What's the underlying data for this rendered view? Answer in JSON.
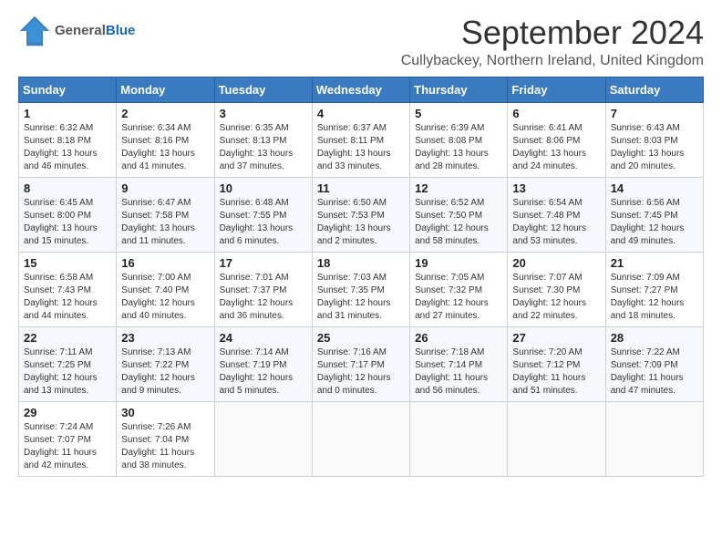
{
  "header": {
    "logo_line1": "General",
    "logo_line2": "Blue",
    "month_title": "September 2024",
    "subtitle": "Cullybackey, Northern Ireland, United Kingdom"
  },
  "days_of_week": [
    "Sunday",
    "Monday",
    "Tuesday",
    "Wednesday",
    "Thursday",
    "Friday",
    "Saturday"
  ],
  "weeks": [
    [
      {
        "day": "1",
        "sunrise": "Sunrise: 6:32 AM",
        "sunset": "Sunset: 8:18 PM",
        "daylight": "Daylight: 13 hours and 46 minutes."
      },
      {
        "day": "2",
        "sunrise": "Sunrise: 6:34 AM",
        "sunset": "Sunset: 8:16 PM",
        "daylight": "Daylight: 13 hours and 41 minutes."
      },
      {
        "day": "3",
        "sunrise": "Sunrise: 6:35 AM",
        "sunset": "Sunset: 8:13 PM",
        "daylight": "Daylight: 13 hours and 37 minutes."
      },
      {
        "day": "4",
        "sunrise": "Sunrise: 6:37 AM",
        "sunset": "Sunset: 8:11 PM",
        "daylight": "Daylight: 13 hours and 33 minutes."
      },
      {
        "day": "5",
        "sunrise": "Sunrise: 6:39 AM",
        "sunset": "Sunset: 8:08 PM",
        "daylight": "Daylight: 13 hours and 28 minutes."
      },
      {
        "day": "6",
        "sunrise": "Sunrise: 6:41 AM",
        "sunset": "Sunset: 8:06 PM",
        "daylight": "Daylight: 13 hours and 24 minutes."
      },
      {
        "day": "7",
        "sunrise": "Sunrise: 6:43 AM",
        "sunset": "Sunset: 8:03 PM",
        "daylight": "Daylight: 13 hours and 20 minutes."
      }
    ],
    [
      {
        "day": "8",
        "sunrise": "Sunrise: 6:45 AM",
        "sunset": "Sunset: 8:00 PM",
        "daylight": "Daylight: 13 hours and 15 minutes."
      },
      {
        "day": "9",
        "sunrise": "Sunrise: 6:47 AM",
        "sunset": "Sunset: 7:58 PM",
        "daylight": "Daylight: 13 hours and 11 minutes."
      },
      {
        "day": "10",
        "sunrise": "Sunrise: 6:48 AM",
        "sunset": "Sunset: 7:55 PM",
        "daylight": "Daylight: 13 hours and 6 minutes."
      },
      {
        "day": "11",
        "sunrise": "Sunrise: 6:50 AM",
        "sunset": "Sunset: 7:53 PM",
        "daylight": "Daylight: 13 hours and 2 minutes."
      },
      {
        "day": "12",
        "sunrise": "Sunrise: 6:52 AM",
        "sunset": "Sunset: 7:50 PM",
        "daylight": "Daylight: 12 hours and 58 minutes."
      },
      {
        "day": "13",
        "sunrise": "Sunrise: 6:54 AM",
        "sunset": "Sunset: 7:48 PM",
        "daylight": "Daylight: 12 hours and 53 minutes."
      },
      {
        "day": "14",
        "sunrise": "Sunrise: 6:56 AM",
        "sunset": "Sunset: 7:45 PM",
        "daylight": "Daylight: 12 hours and 49 minutes."
      }
    ],
    [
      {
        "day": "15",
        "sunrise": "Sunrise: 6:58 AM",
        "sunset": "Sunset: 7:43 PM",
        "daylight": "Daylight: 12 hours and 44 minutes."
      },
      {
        "day": "16",
        "sunrise": "Sunrise: 7:00 AM",
        "sunset": "Sunset: 7:40 PM",
        "daylight": "Daylight: 12 hours and 40 minutes."
      },
      {
        "day": "17",
        "sunrise": "Sunrise: 7:01 AM",
        "sunset": "Sunset: 7:37 PM",
        "daylight": "Daylight: 12 hours and 36 minutes."
      },
      {
        "day": "18",
        "sunrise": "Sunrise: 7:03 AM",
        "sunset": "Sunset: 7:35 PM",
        "daylight": "Daylight: 12 hours and 31 minutes."
      },
      {
        "day": "19",
        "sunrise": "Sunrise: 7:05 AM",
        "sunset": "Sunset: 7:32 PM",
        "daylight": "Daylight: 12 hours and 27 minutes."
      },
      {
        "day": "20",
        "sunrise": "Sunrise: 7:07 AM",
        "sunset": "Sunset: 7:30 PM",
        "daylight": "Daylight: 12 hours and 22 minutes."
      },
      {
        "day": "21",
        "sunrise": "Sunrise: 7:09 AM",
        "sunset": "Sunset: 7:27 PM",
        "daylight": "Daylight: 12 hours and 18 minutes."
      }
    ],
    [
      {
        "day": "22",
        "sunrise": "Sunrise: 7:11 AM",
        "sunset": "Sunset: 7:25 PM",
        "daylight": "Daylight: 12 hours and 13 minutes."
      },
      {
        "day": "23",
        "sunrise": "Sunrise: 7:13 AM",
        "sunset": "Sunset: 7:22 PM",
        "daylight": "Daylight: 12 hours and 9 minutes."
      },
      {
        "day": "24",
        "sunrise": "Sunrise: 7:14 AM",
        "sunset": "Sunset: 7:19 PM",
        "daylight": "Daylight: 12 hours and 5 minutes."
      },
      {
        "day": "25",
        "sunrise": "Sunrise: 7:16 AM",
        "sunset": "Sunset: 7:17 PM",
        "daylight": "Daylight: 12 hours and 0 minutes."
      },
      {
        "day": "26",
        "sunrise": "Sunrise: 7:18 AM",
        "sunset": "Sunset: 7:14 PM",
        "daylight": "Daylight: 11 hours and 56 minutes."
      },
      {
        "day": "27",
        "sunrise": "Sunrise: 7:20 AM",
        "sunset": "Sunset: 7:12 PM",
        "daylight": "Daylight: 11 hours and 51 minutes."
      },
      {
        "day": "28",
        "sunrise": "Sunrise: 7:22 AM",
        "sunset": "Sunset: 7:09 PM",
        "daylight": "Daylight: 11 hours and 47 minutes."
      }
    ],
    [
      {
        "day": "29",
        "sunrise": "Sunrise: 7:24 AM",
        "sunset": "Sunset: 7:07 PM",
        "daylight": "Daylight: 11 hours and 42 minutes."
      },
      {
        "day": "30",
        "sunrise": "Sunrise: 7:26 AM",
        "sunset": "Sunset: 7:04 PM",
        "daylight": "Daylight: 11 hours and 38 minutes."
      },
      null,
      null,
      null,
      null,
      null
    ]
  ]
}
